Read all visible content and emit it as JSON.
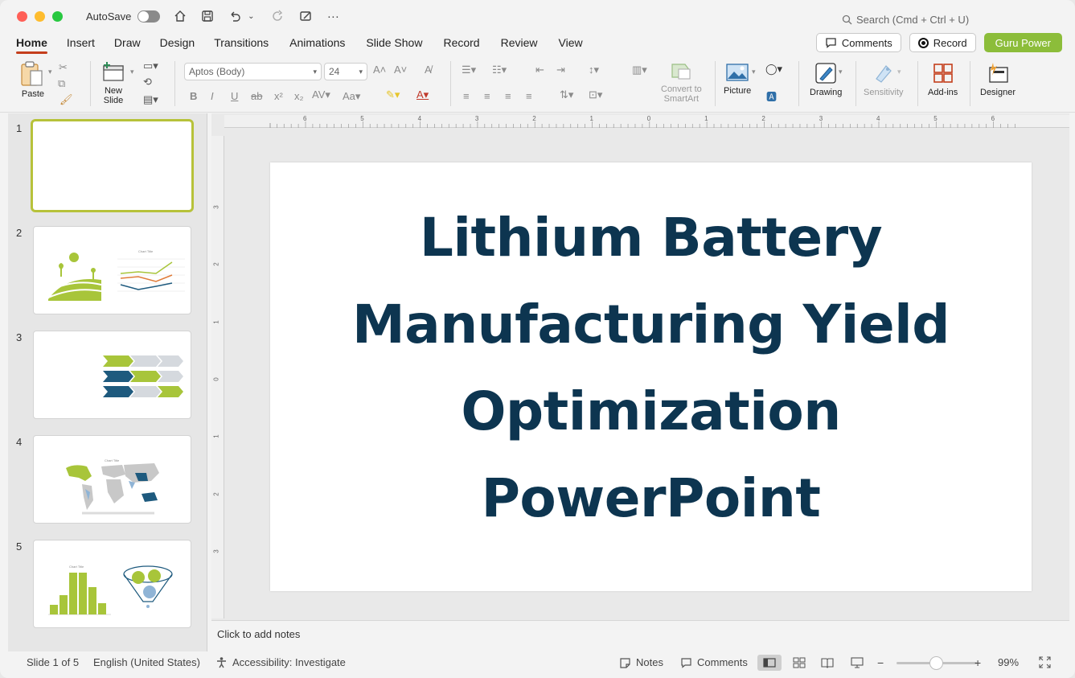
{
  "titlebar": {
    "autosave_label": "AutoSave",
    "autosave_on": false,
    "search_placeholder": "Search (Cmd + Ctrl + U)",
    "traffic_colors": [
      "#ff5f57",
      "#febc2e",
      "#28c840"
    ]
  },
  "tabs": [
    "Home",
    "Insert",
    "Draw",
    "Design",
    "Transitions",
    "Animations",
    "Slide Show",
    "Record",
    "Review",
    "View"
  ],
  "active_tab": "Home",
  "top_buttons": {
    "comments": "Comments",
    "record": "Record",
    "guru": "Guru Power"
  },
  "ribbon": {
    "paste": "Paste",
    "new_slide": "New\nSlide",
    "font_name": "Aptos (Body)",
    "font_size": "24",
    "convert_smartart": "Convert to\nSmartArt",
    "picture": "Picture",
    "drawing": "Drawing",
    "sensitivity": "Sensitivity",
    "addins": "Add-ins",
    "designer": "Designer"
  },
  "ruler": {
    "h_labels": [
      "6",
      "5",
      "4",
      "3",
      "2",
      "1",
      "0",
      "1",
      "2",
      "3",
      "4",
      "5",
      "6"
    ],
    "v_labels": [
      "3",
      "2",
      "1",
      "0",
      "1",
      "2",
      "3"
    ]
  },
  "slides": [
    {
      "num": "1",
      "selected": true
    },
    {
      "num": "2",
      "selected": false,
      "chart_title": "Chart Title"
    },
    {
      "num": "3",
      "selected": false
    },
    {
      "num": "4",
      "selected": false,
      "chart_title": "Chart Title"
    },
    {
      "num": "5",
      "selected": false,
      "chart_title": "Chart Title"
    }
  ],
  "slide": {
    "title_lines": [
      "Lithium Battery",
      "Manufacturing Yield",
      "Optimization",
      "PowerPoint"
    ],
    "title_color": "#0d3550"
  },
  "notes_placeholder": "Click to add notes",
  "statusbar": {
    "slide_info": "Slide 1 of 5",
    "language": "English (United States)",
    "accessibility": "Accessibility: Investigate",
    "notes": "Notes",
    "comments": "Comments",
    "zoom": "99%"
  },
  "accent_colors": {
    "brand_green": "#8cbd3a",
    "olive": "#a8c53a",
    "navy": "#1e5a7e",
    "active_tab_underline": "#c43e1c"
  }
}
